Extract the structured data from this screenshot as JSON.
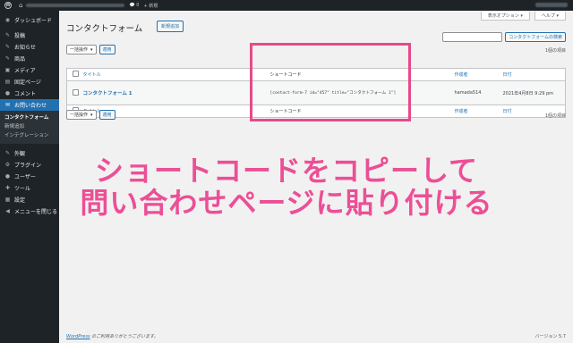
{
  "admin_bar": {
    "comments_count": "0",
    "new_label": "+ 新規"
  },
  "sidebar": {
    "items": [
      {
        "icon": "gauge-icon",
        "glyph": "◉",
        "label": "ダッシュボード"
      },
      {
        "icon": "pin-icon",
        "glyph": "✎",
        "label": "投稿"
      },
      {
        "icon": "pin-icon",
        "glyph": "✎",
        "label": "お知らせ"
      },
      {
        "icon": "pin-icon",
        "glyph": "✎",
        "label": "商品"
      },
      {
        "icon": "media-icon",
        "glyph": "▣",
        "label": "メディア"
      },
      {
        "icon": "page-icon",
        "glyph": "▤",
        "label": "固定ページ"
      },
      {
        "icon": "comment-icon",
        "glyph": "●",
        "label": "コメント"
      },
      {
        "icon": "mail-icon",
        "glyph": "✉",
        "label": "お問い合わせ"
      }
    ],
    "submenu": [
      "コンタクトフォーム",
      "新規追加",
      "インテグレーション"
    ],
    "items2": [
      {
        "icon": "brush-icon",
        "glyph": "✎",
        "label": "外観"
      },
      {
        "icon": "plugin-icon",
        "glyph": "⚙",
        "label": "プラグイン"
      },
      {
        "icon": "users-icon",
        "glyph": "●",
        "label": "ユーザー"
      },
      {
        "icon": "tools-icon",
        "glyph": "✚",
        "label": "ツール"
      },
      {
        "icon": "settings-icon",
        "glyph": "▦",
        "label": "設定"
      },
      {
        "icon": "collapse-icon",
        "glyph": "◀",
        "label": "メニューを閉じる"
      }
    ]
  },
  "screen_options": "表示オプション ▾",
  "help": "ヘルプ ▾",
  "page_title": "コンタクトフォーム",
  "add_new": "新規追加",
  "search_button": "コンタクトフォームの検索",
  "bulk_action": "一括操作",
  "apply": "適用",
  "item_count": "1個の項目",
  "columns": {
    "title": "タイトル",
    "shortcode": "ショートコード",
    "author": "作成者",
    "date": "日付"
  },
  "rows": [
    {
      "title": "コンタクトフォーム 1",
      "shortcode": "[contact-form-7 id=\"457\" title=\"コンタクトフォーム 1\"]",
      "author": "hamada514",
      "date": "2021年4月8日 9:29 pm"
    }
  ],
  "footer": {
    "wordpress": "WordPress",
    "thanks": " のご利用ありがとうございます。",
    "version": "バージョン 5.7"
  },
  "annotation": {
    "line1": "ショートコードをコピーして",
    "line2": "問い合わせページに貼り付ける",
    "color": "#ec4f96"
  }
}
